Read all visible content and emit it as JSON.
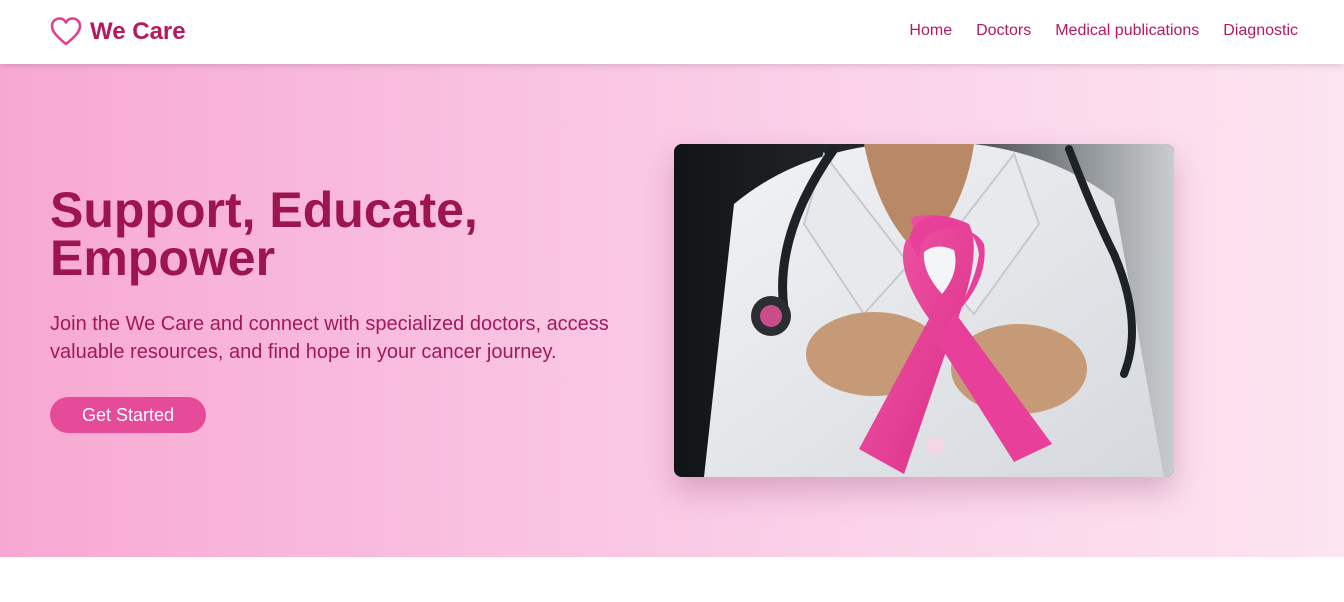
{
  "brand": {
    "name": "We Care",
    "icon": "heart-icon",
    "color": "#b8185f"
  },
  "nav": {
    "items": [
      {
        "label": "Home"
      },
      {
        "label": "Doctors"
      },
      {
        "label": "Medical publications"
      },
      {
        "label": "Diagnostic"
      }
    ]
  },
  "hero": {
    "title": "Support, Educate, Empower",
    "subtitle": "Join the We Care and connect with specialized doctors, access valuable resources, and find hope in your cancer journey.",
    "cta_label": "Get Started",
    "image_icon": "doctor-holding-pink-ribbon"
  },
  "colors": {
    "accent": "#e64b99",
    "heading": "#9d1550",
    "gradient_start": "#f7a8d2",
    "gradient_end": "#fce4f0"
  }
}
